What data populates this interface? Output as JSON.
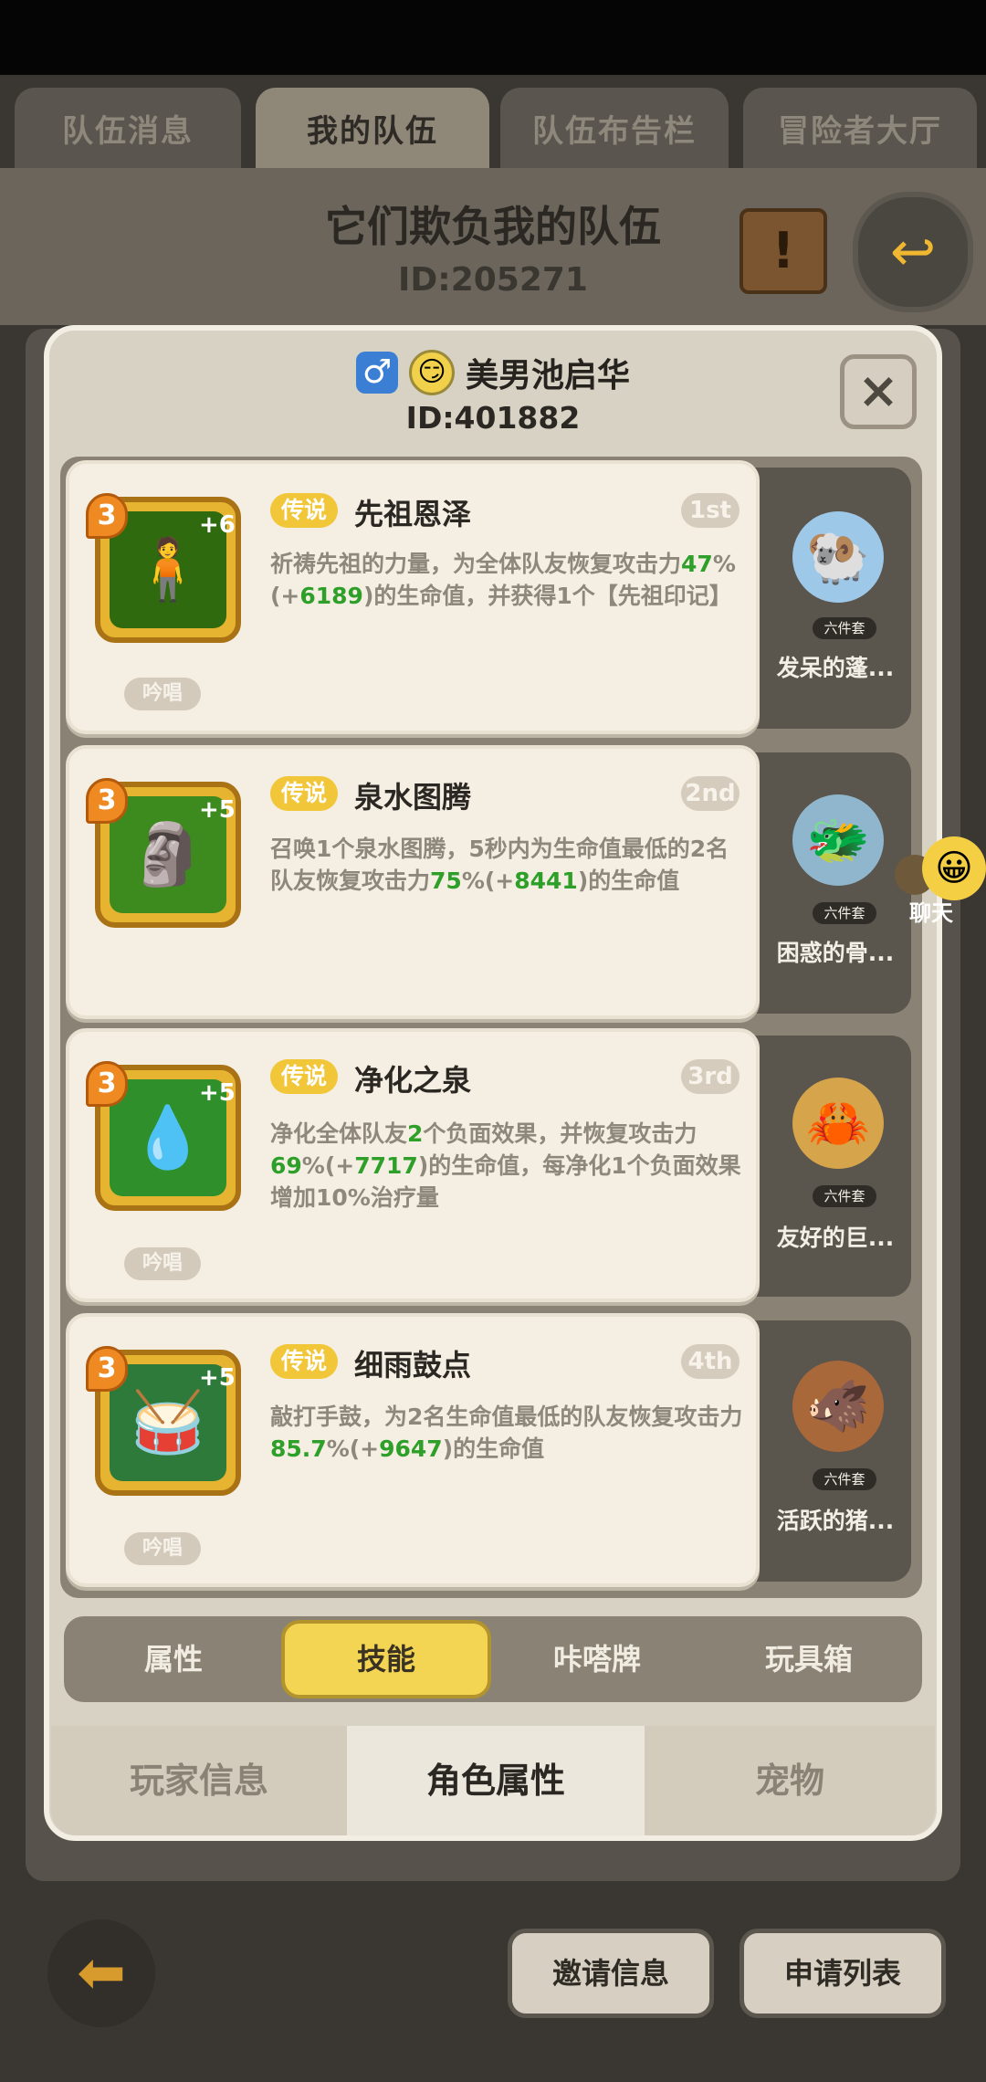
{
  "top_tabs": [
    "队伍消息",
    "我的队伍",
    "队伍布告栏",
    "冒险者大厅"
  ],
  "team": {
    "title": "它们欺负我的队伍",
    "id": "ID:205271"
  },
  "player": {
    "gender": "♂",
    "name": "美男池启华",
    "id": "ID:401882"
  },
  "close_label": "×",
  "skills": [
    {
      "level": "3",
      "plus": "+6",
      "rarity": "传说",
      "name": "先祖恩泽",
      "rank": "1st",
      "desc_parts": [
        "祈祷先祖的力量，为全体队友恢复攻击力",
        "47",
        "%(+",
        "6189",
        ")的生命值，并获得1个【先祖印记】"
      ],
      "chant": "吟唱",
      "icon": "spirit-icon"
    },
    {
      "level": "3",
      "plus": "+5",
      "rarity": "传说",
      "name": "泉水图腾",
      "rank": "2nd",
      "desc_parts": [
        "召唤1个泉水图腾，5秒内为生命值最低的2名队友恢复攻击力",
        "75",
        "%(+",
        "8441",
        ")的生命值"
      ],
      "chant": "",
      "icon": "totem-icon"
    },
    {
      "level": "3",
      "plus": "+5",
      "rarity": "传说",
      "name": "净化之泉",
      "rank": "3rd",
      "desc_parts": [
        "净化全体队友",
        "2",
        "个负面效果，并恢复攻击力",
        "69",
        "%(+",
        "7717",
        ")的生命值，每净化1个负面效果增加10%治疗量"
      ],
      "chant": "吟唱",
      "icon": "droplet-icon"
    },
    {
      "level": "3",
      "plus": "+5",
      "rarity": "传说",
      "name": "细雨鼓点",
      "rank": "4th",
      "desc_parts": [
        "敲打手鼓，为2名生命值最低的队友恢复攻击力",
        "85.7",
        "%(+",
        "9647",
        ")的生命值"
      ],
      "chant": "吟唱",
      "icon": "drum-icon"
    }
  ],
  "pets": [
    {
      "badge": "六件套",
      "name": "发呆的蓬...",
      "emoji": "🐏"
    },
    {
      "badge": "六件套",
      "name": "困惑的骨...",
      "emoji": "🐲"
    },
    {
      "badge": "六件套",
      "name": "友好的巨...",
      "emoji": "🦀"
    },
    {
      "badge": "六件套",
      "name": "活跃的猪...",
      "emoji": "🐗"
    }
  ],
  "inner_tabs": [
    "属性",
    "技能",
    "咔嗒牌",
    "玩具箱"
  ],
  "bottom_tabs": [
    "玩家信息",
    "角色属性",
    "宠物"
  ],
  "chat_label": "聊天",
  "bottom_buttons": [
    "邀请信息",
    "申请列表"
  ],
  "colors": {
    "accent_yellow": "#f4d553",
    "legend_tag": "#f1c638",
    "highlight_green": "#2ea02a"
  }
}
